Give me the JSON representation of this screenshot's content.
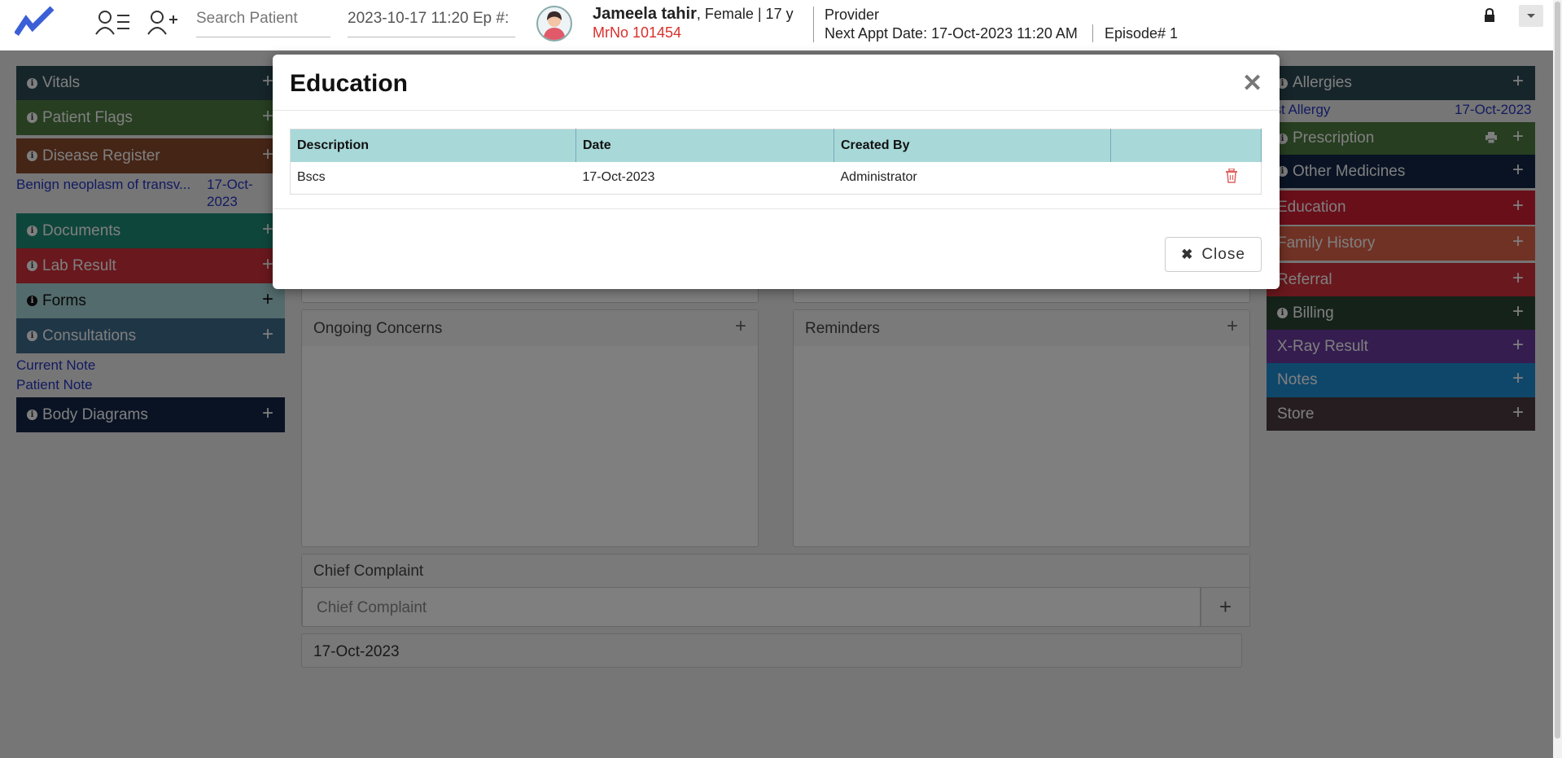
{
  "header": {
    "search_placeholder": "Search Patient",
    "episode_field": "2023-10-17 11:20 Ep #:",
    "patient_name": "Jameela tahir",
    "patient_details": ", Female | 17 y",
    "mrno": "MrNo 101454",
    "provider": "Provider",
    "next_appt_label": "Next Appt Date",
    "next_appt_value": ": 17-Oct-2023 11:20 AM",
    "episode": "Episode# 1"
  },
  "left_panels": {
    "vitals": "Vitals",
    "patient_flags": "Patient Flags",
    "disease_register": "Disease Register",
    "disease_link": "Benign neoplasm of transv...",
    "disease_date_1": "17-Oct-",
    "disease_date_2": "2023",
    "documents": "Documents",
    "lab_result": "Lab Result",
    "forms": "Forms",
    "consultations": "Consultations",
    "current_note": "Current Note",
    "patient_note": "Patient Note",
    "body_diagrams": "Body Diagrams"
  },
  "right_panels": {
    "allergies": "Allergies",
    "allergy_link": "ust Allergy",
    "allergy_date": "17-Oct-2023",
    "prescription": "Prescription",
    "other_medicines": "Other Medicines",
    "education": "Education",
    "family_history": "Family History",
    "referral": "Referral",
    "billing": "Billing",
    "xray_result": "X-Ray Result",
    "notes": "Notes",
    "store": "Store"
  },
  "center": {
    "ongoing_concerns": "Ongoing Concerns",
    "reminders": "Reminders",
    "chief_complaint_title": "Chief Complaint",
    "chief_complaint_placeholder": "Chief Complaint",
    "chief_complaint_date": "17-Oct-2023"
  },
  "modal": {
    "title": "Education",
    "columns": [
      "Description",
      "Date",
      "Created By",
      ""
    ],
    "rows": [
      {
        "description": "Bscs",
        "date": "17-Oct-2023",
        "created_by": "Administrator"
      }
    ],
    "close_label": "Close"
  },
  "colors": {
    "vitals": "#2c4a55",
    "patient_flags": "#4e7d42",
    "disease_register": "#8a4a2c",
    "documents": "#1f8c78",
    "lab_result": "#d2303b",
    "forms": "#a6d7d9",
    "consultations": "#3f6c8c",
    "body_diagrams": "#122748",
    "allergies": "#2c4a55",
    "prescription": "#4e7d42",
    "other_medicines": "#122748",
    "education": "#d21f35",
    "family_history": "#e0644a",
    "referral": "#d2303b",
    "billing": "#2a4432",
    "xray_result": "#6a3aa0",
    "notes": "#1f8fd6",
    "store": "#4a3a3f",
    "table_header": "#a8d8d8"
  }
}
